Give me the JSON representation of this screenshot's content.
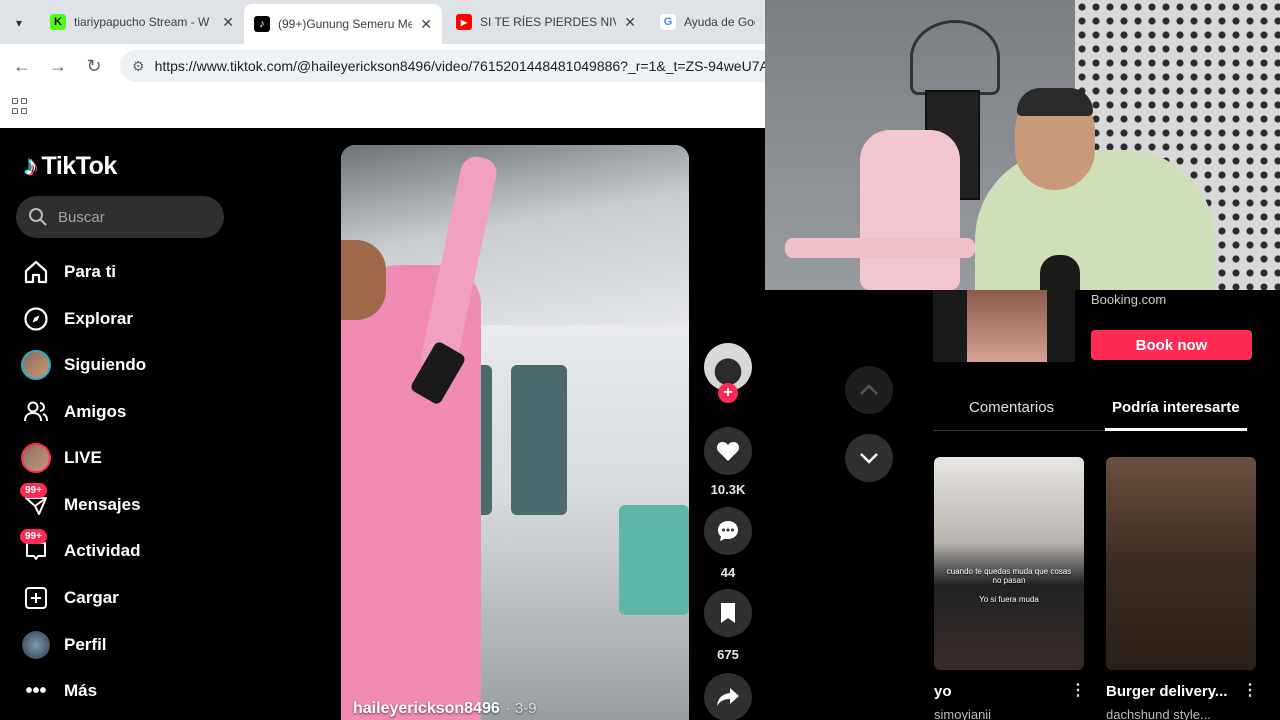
{
  "browser": {
    "tabs": [
      {
        "label": "tiariypapucho Stream - W",
        "favicon_color": "#53fc18",
        "favicon_glyph": "K"
      },
      {
        "label": "(99+)Gunung Semeru Me",
        "favicon_color": "#000000",
        "favicon_glyph": "♪"
      },
      {
        "label": "SI TE RÍES PIERDES NIVEL",
        "favicon_color": "#ff0000",
        "favicon_glyph": "▶"
      },
      {
        "label": "Ayuda de Goog",
        "favicon_color": "#4285f4",
        "favicon_glyph": "G"
      }
    ],
    "active_tab_index": 1,
    "url": "https://www.tiktok.com/@haileyerickson8496/video/7615201448481049886?_r=1&_t=ZS-94weU7A"
  },
  "sidebar": {
    "logo": "TikTok",
    "search_placeholder": "Buscar",
    "items": [
      {
        "label": "Para ti",
        "icon": "home-icon"
      },
      {
        "label": "Explorar",
        "icon": "compass-icon"
      },
      {
        "label": "Siguiendo",
        "icon": "following-avatar-icon"
      },
      {
        "label": "Amigos",
        "icon": "friends-icon"
      },
      {
        "label": "LIVE",
        "icon": "live-avatar-icon"
      },
      {
        "label": "Mensajes",
        "icon": "inbox-icon",
        "badge": "99+"
      },
      {
        "label": "Actividad",
        "icon": "activity-icon",
        "badge": "99+"
      },
      {
        "label": "Cargar",
        "icon": "upload-icon"
      },
      {
        "label": "Perfil",
        "icon": "profile-avatar-icon"
      },
      {
        "label": "Más",
        "icon": "more-dots-icon"
      }
    ]
  },
  "video": {
    "username": "haileyerickson8496",
    "date": "· 3-9",
    "likes": "10.3K",
    "comments": "44",
    "saves": "675"
  },
  "right_panel": {
    "ad_brand": "Booking.com",
    "ad_button": "Book now",
    "tabs": [
      "Comentarios",
      "Podría interesarte"
    ],
    "active_tab": "Podría interesarte",
    "recommendations": [
      {
        "title": "yo",
        "user": "simoyianii",
        "caption_1": "cuando te quedas muda que cosas no pasan",
        "caption_2": "Yo si fuera muda"
      },
      {
        "title": "Burger delivery...",
        "user": "dachshund style..."
      }
    ]
  },
  "colors": {
    "accent": "#fe2c55",
    "background": "#000000",
    "teal": "#25f4ee"
  }
}
